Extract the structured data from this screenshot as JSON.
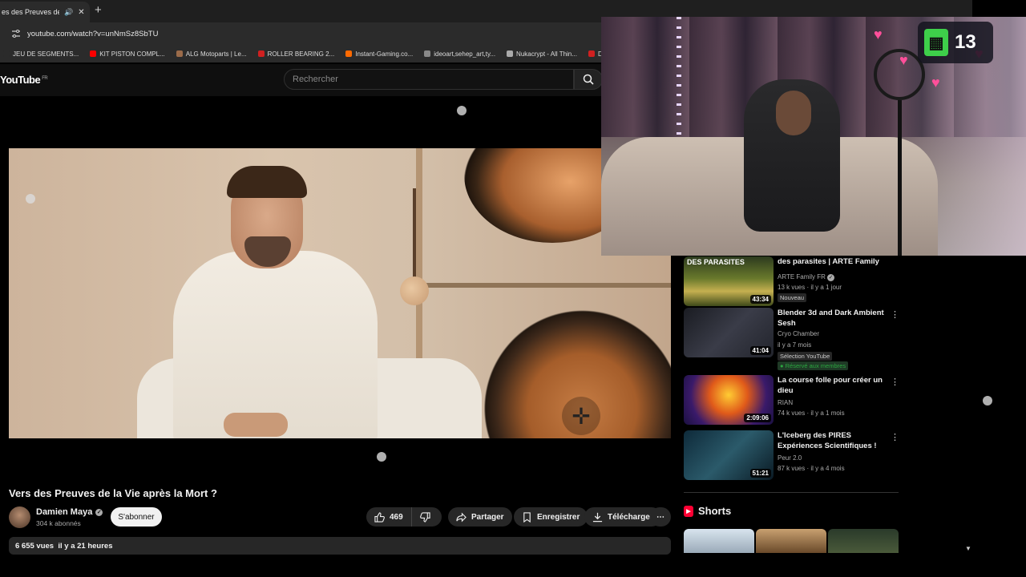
{
  "browser": {
    "tab_title": "es des Preuves de la V",
    "url": "youtube.com/watch?v=unNmSz8SbTU",
    "bookmarks": [
      {
        "label": "JEU DE SEGMENTS...",
        "color": "#2b2b2b"
      },
      {
        "label": "KIT PISTON COMPL...",
        "color": "#ff0000"
      },
      {
        "label": "ALG Motoparts | Le...",
        "color": "#9b6b4a"
      },
      {
        "label": "ROLLER BEARING 2...",
        "color": "#d02020"
      },
      {
        "label": "Instant-Gaming.co...",
        "color": "#ff6a00"
      },
      {
        "label": "ideoart,sehep_art,ty...",
        "color": "#888888"
      },
      {
        "label": "Nukacrypt - All Thin...",
        "color": "#aaaaaa"
      },
      {
        "label": "D",
        "color": "#d02020"
      }
    ]
  },
  "youtube": {
    "logo": "YouTube",
    "region": "FR",
    "search_placeholder": "Rechercher"
  },
  "video": {
    "title": "Vers des Preuves de la Vie après la Mort ?",
    "channel": "Damien Maya",
    "subscribers": "304 k abonnés",
    "subscribe_label": "S'abonner",
    "likes": "469",
    "share_label": "Partager",
    "save_label": "Enregistrer",
    "download_label": "Télécharger",
    "views": "6 655 vues",
    "date": "il y a 21 heures"
  },
  "recommendations": [
    {
      "title": "des parasites | ARTE Family",
      "thumb_caption": "DES PARASITES",
      "channel": "ARTE Family FR",
      "meta": "13 k vues · il y a 1 jour",
      "badge": "Nouveau",
      "duration": "43:34"
    },
    {
      "title": "Blender 3d and Dark Ambient Sesh",
      "channel": "Cryo Chamber",
      "meta": "il y a 7 mois",
      "badge": "Sélection YouTube",
      "members": "Réservé aux membres",
      "duration": "41:04"
    },
    {
      "title": "La course folle pour créer un dieu",
      "channel": "RIAN",
      "meta": "74 k vues · il y a 1 mois",
      "duration": "2:09:06"
    },
    {
      "title": "L'Iceberg des PIRES Expériences Scientifiques !",
      "channel": "Peur 2.0",
      "meta": "87 k vues · il y a 4 mois",
      "duration": "51:21"
    }
  ],
  "shorts": {
    "label": "Shorts"
  },
  "overlay": {
    "count": "13"
  },
  "colors": {
    "accent": "#ff0033",
    "background": "#0f0f0f",
    "panel": "#272727"
  }
}
